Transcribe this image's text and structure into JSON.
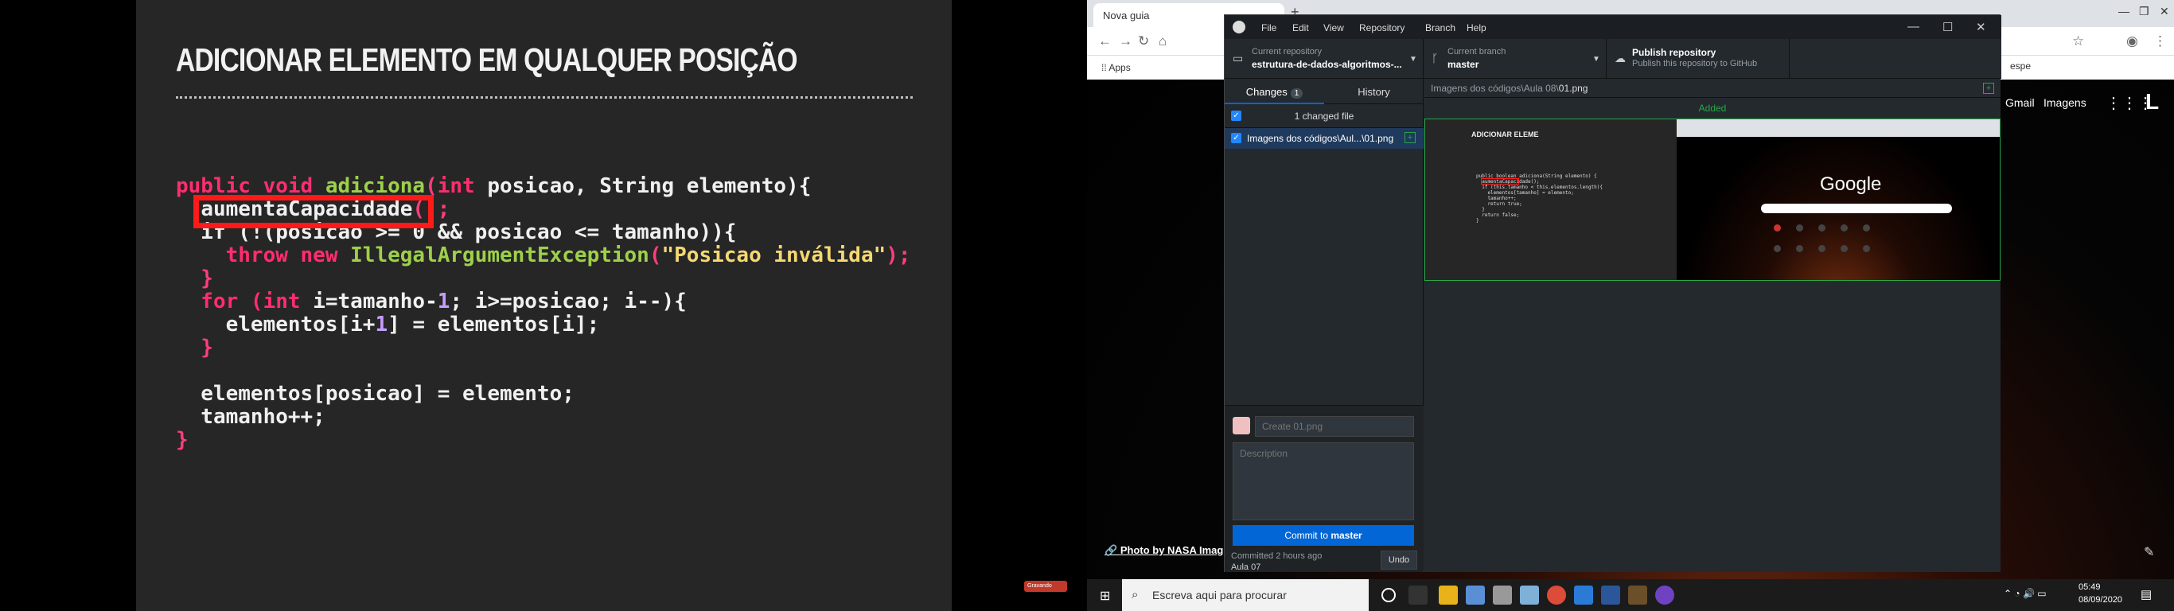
{
  "slide": {
    "title": "ADICIONAR ELEMENTO EM QUALQUER POSIÇÃO",
    "code": {
      "l1_a": "public void adiciona(",
      "l1_b": "int",
      "l1_c": " posicao, String elemento){",
      "l2": "aumentaCapacidade",
      "l2_b": "();",
      "l3_a": "  if (!(posicao >= 0 && posicao <= tamanho)){",
      "l4_a": "    throw new ",
      "l4_b": "IllegalArgumentException",
      "l4_c": "(",
      "l4_d": "\"Posicao inválida\"",
      "l4_e": ");",
      "l5": "  }",
      "l6_a": "  for (",
      "l6_b": "int",
      "l6_c": " i=tamanho-",
      "l6_d": "1",
      "l6_e": "; i>=posicao; i--){",
      "l7_a": "    elementos[i+",
      "l7_b": "1",
      "l7_c": "] = elementos[i];",
      "l8": "  }",
      "l9": "",
      "l10": "  elementos[posicao] = elemento;",
      "l11": "  tamanho++;",
      "l12": "}"
    }
  },
  "browser": {
    "tab_title": "Nova guia",
    "new_tab": "+",
    "bookmarks_apps": "Apps",
    "bookmark_right": "espe",
    "gmail": "Gmail",
    "imagens": "Imagens",
    "avatar_letter": "L",
    "photo_credit": "Photo by NASA Imag",
    "rec_label": "Gravando"
  },
  "github": {
    "menu": [
      "File",
      "Edit",
      "View",
      "Repository",
      "Branch",
      "Help"
    ],
    "current_repo_label": "Current repository",
    "current_repo_value": "estrutura-de-dados-algoritmos-...",
    "current_branch_label": "Current branch",
    "current_branch_value": "master",
    "publish_title": "Publish repository",
    "publish_subtitle": "Publish this repository to GitHub",
    "tab_changes": "Changes",
    "changes_count": "1",
    "tab_history": "History",
    "changed_files_header": "1 changed file",
    "file_name": "Imagens dos códigos\\Aul...\\01.png",
    "diff_path_prefix": "Imagens dos códigos\\Aula 08\\",
    "diff_path_file": "01.png",
    "added_label": "Added",
    "summary_placeholder": "Create 01.png",
    "description_placeholder": "Description",
    "commit_button_prefix": "Commit to ",
    "commit_button_branch": "master",
    "committed_when": "Committed 2 hours ago",
    "committed_message": "Aula 07",
    "undo_label": "Undo",
    "thumb_title": "ADICIONAR ELEME",
    "thumb_google": "Google"
  },
  "taskbar": {
    "search_text": "Escreva aqui para procurar",
    "time": "05:49",
    "date": "08/09/2020"
  }
}
